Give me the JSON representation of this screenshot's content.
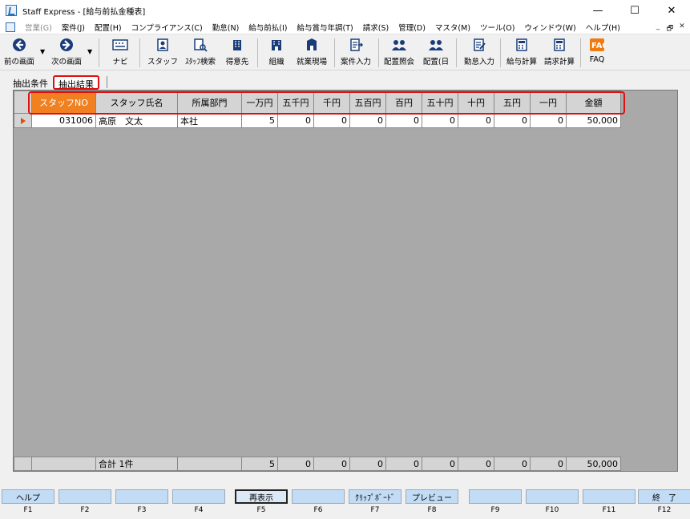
{
  "window": {
    "title": "Staff Express - [給与前払金種表]",
    "minimize": "—",
    "maximize": "☐",
    "close": "✕"
  },
  "menu": [
    {
      "label": "営業(G)",
      "disabled": true
    },
    {
      "label": "案件(J)"
    },
    {
      "label": "配置(H)"
    },
    {
      "label": "コンプライアンス(C)"
    },
    {
      "label": "勤怠(N)"
    },
    {
      "label": "給与前払(I)"
    },
    {
      "label": "給与賞与年調(T)"
    },
    {
      "label": "請求(S)"
    },
    {
      "label": "管理(D)"
    },
    {
      "label": "マスタ(M)"
    },
    {
      "label": "ツール(O)"
    },
    {
      "label": "ウィンドウ(W)"
    },
    {
      "label": "ヘルプ(H)"
    }
  ],
  "mdi_controls": [
    "_",
    "🗗",
    "✕"
  ],
  "toolbar": {
    "prev": "前の画面",
    "next": "次の画面",
    "navi": "ナビ",
    "staff": "スタッフ",
    "staff_search": "ｽﾀｯﾌ検索",
    "client": "得意先",
    "org": "組織",
    "worksite": "就業現場",
    "case_input": "案件入力",
    "assign_view": "配置照会",
    "assign_day": "配置(日",
    "attendance_input": "勤怠入力",
    "payroll_calc": "給与計算",
    "billing_calc": "請求計算",
    "faq": "FAQ"
  },
  "tabs": {
    "conditions": "抽出条件",
    "results": "抽出結果"
  },
  "grid": {
    "columns": [
      "スタッフNO",
      "スタッフ氏名",
      "所属部門",
      "一万円",
      "五千円",
      "千円",
      "五百円",
      "百円",
      "五十円",
      "十円",
      "五円",
      "一円",
      "金額"
    ],
    "rows": [
      [
        "031006",
        "高原　文太",
        "本社",
        "5",
        "0",
        "0",
        "0",
        "0",
        "0",
        "0",
        "0",
        "0",
        "50,000"
      ]
    ],
    "total": [
      "",
      "合計 1件",
      "",
      "5",
      "0",
      "0",
      "0",
      "0",
      "0",
      "0",
      "0",
      "0",
      "50,000"
    ]
  },
  "fkeys": [
    {
      "label": "ヘルプ",
      "key": "F1"
    },
    {
      "label": "",
      "key": "F2"
    },
    {
      "label": "",
      "key": "F3"
    },
    {
      "label": "",
      "key": "F4"
    },
    {
      "label": "再表示",
      "key": "F5"
    },
    {
      "label": "",
      "key": "F6"
    },
    {
      "label": "ｸﾘｯﾌﾟﾎﾞｰﾄﾞ",
      "key": "F7"
    },
    {
      "label": "プレビュー",
      "key": "F8"
    },
    {
      "label": "",
      "key": "F9"
    },
    {
      "label": "",
      "key": "F10"
    },
    {
      "label": "",
      "key": "F11"
    },
    {
      "label": "終　了",
      "key": "F12"
    }
  ],
  "colors": {
    "selected_header": "#f08020",
    "highlight": "#e01010",
    "fkey_bg": "#c3dcf5",
    "grid_bg": "#a9a9a9"
  }
}
